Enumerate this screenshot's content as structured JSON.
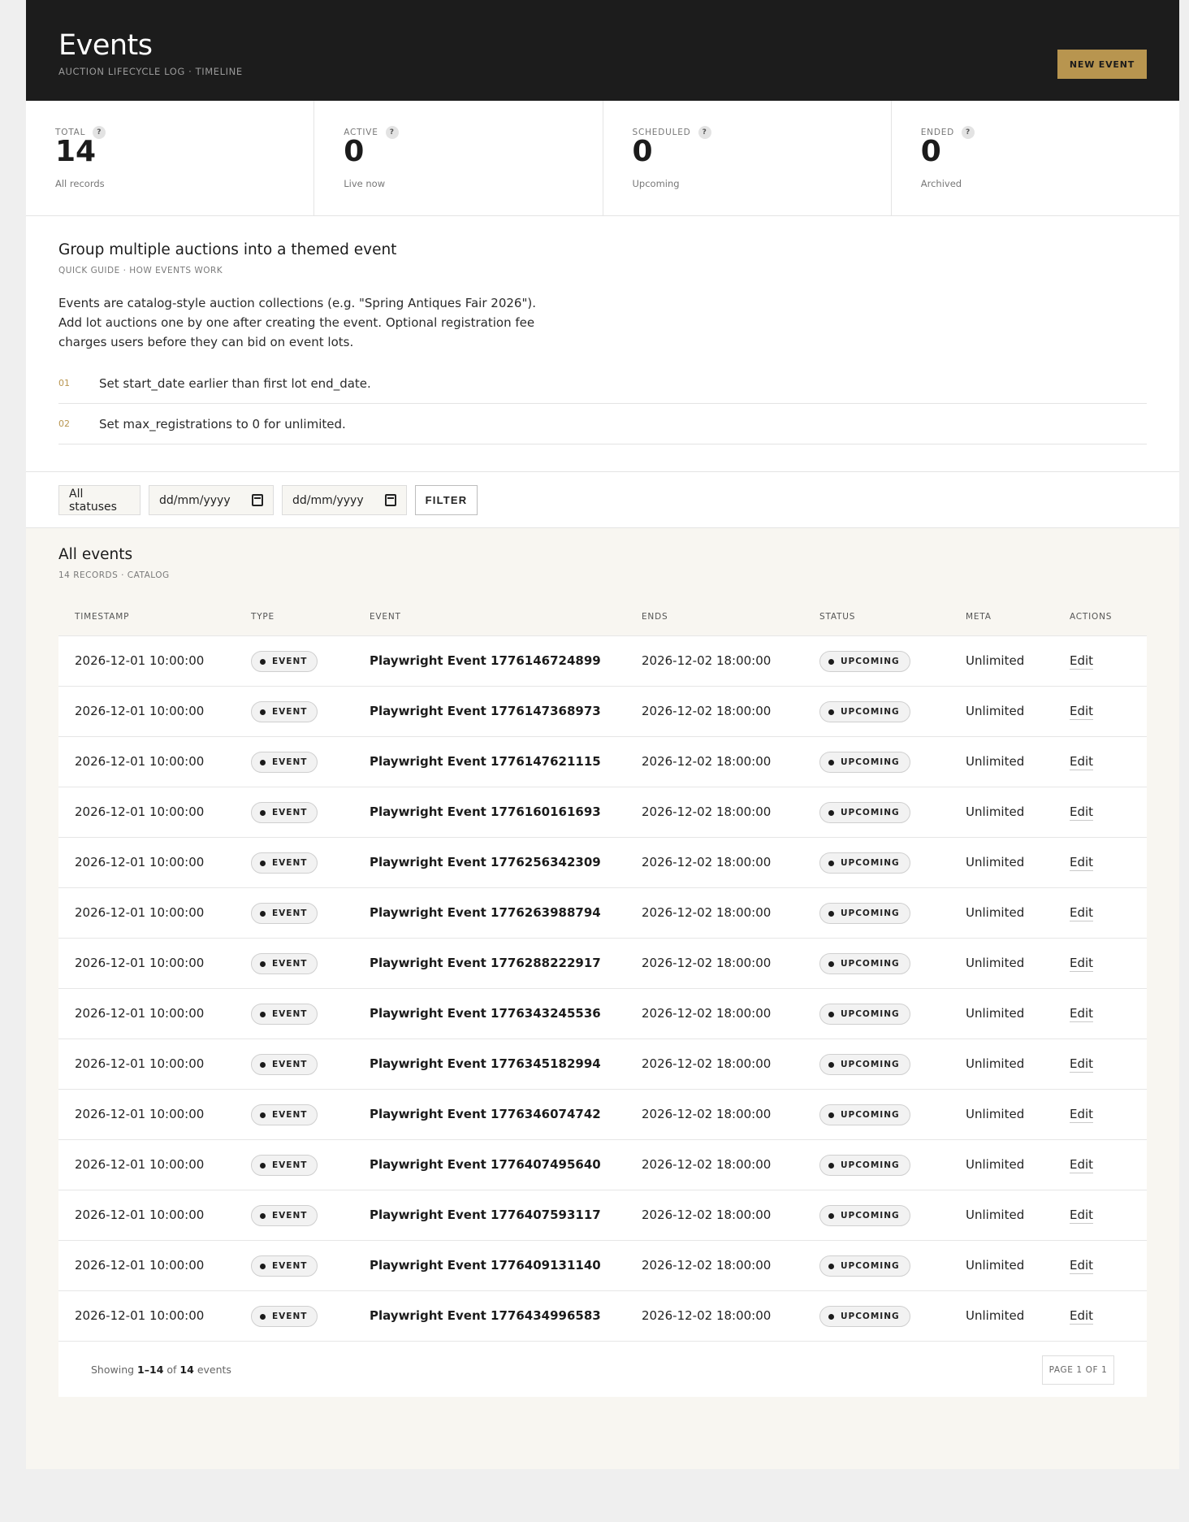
{
  "header": {
    "title": "Events",
    "subtitle": "AUCTION LIFECYCLE LOG · TIMELINE",
    "new_button": "NEW EVENT"
  },
  "stats": [
    {
      "label": "TOTAL",
      "value": "14",
      "caption": "All records"
    },
    {
      "label": "ACTIVE",
      "value": "0",
      "caption": "Live now"
    },
    {
      "label": "SCHEDULED",
      "value": "0",
      "caption": "Upcoming"
    },
    {
      "label": "ENDED",
      "value": "0",
      "caption": "Archived"
    }
  ],
  "help_glyph": "?",
  "guide": {
    "title": "Group multiple auctions into a themed event",
    "subtitle": "QUICK GUIDE · HOW EVENTS WORK",
    "description": "Events are catalog-style auction collections (e.g. \"Spring Antiques Fair 2026\"). Add lot auctions one by one after creating the event. Optional registration fee charges users before they can bid on event lots.",
    "steps": [
      {
        "num": "01",
        "text": "Set start_date earlier than first lot end_date."
      },
      {
        "num": "02",
        "text": "Set max_registrations to 0 for unlimited."
      }
    ]
  },
  "filters": {
    "status_select": "All statuses",
    "date_from_placeholder": "dd/mm/yyyy",
    "date_to_placeholder": "dd/mm/yyyy",
    "filter_button": "FILTER"
  },
  "list": {
    "title": "All events",
    "subtitle": "14 RECORDS · CATALOG",
    "columns": [
      "TIMESTAMP",
      "TYPE",
      "EVENT",
      "ENDS",
      "STATUS",
      "META",
      "ACTIONS"
    ],
    "rows": [
      {
        "timestamp": "2026-12-01 10:00:00",
        "type": "EVENT",
        "event": "Playwright Event 1776146724899",
        "ends": "2026-12-02 18:00:00",
        "status": "UPCOMING",
        "meta": "Unlimited",
        "action": "Edit"
      },
      {
        "timestamp": "2026-12-01 10:00:00",
        "type": "EVENT",
        "event": "Playwright Event 1776147368973",
        "ends": "2026-12-02 18:00:00",
        "status": "UPCOMING",
        "meta": "Unlimited",
        "action": "Edit"
      },
      {
        "timestamp": "2026-12-01 10:00:00",
        "type": "EVENT",
        "event": "Playwright Event 1776147621115",
        "ends": "2026-12-02 18:00:00",
        "status": "UPCOMING",
        "meta": "Unlimited",
        "action": "Edit"
      },
      {
        "timestamp": "2026-12-01 10:00:00",
        "type": "EVENT",
        "event": "Playwright Event 1776160161693",
        "ends": "2026-12-02 18:00:00",
        "status": "UPCOMING",
        "meta": "Unlimited",
        "action": "Edit"
      },
      {
        "timestamp": "2026-12-01 10:00:00",
        "type": "EVENT",
        "event": "Playwright Event 1776256342309",
        "ends": "2026-12-02 18:00:00",
        "status": "UPCOMING",
        "meta": "Unlimited",
        "action": "Edit"
      },
      {
        "timestamp": "2026-12-01 10:00:00",
        "type": "EVENT",
        "event": "Playwright Event 1776263988794",
        "ends": "2026-12-02 18:00:00",
        "status": "UPCOMING",
        "meta": "Unlimited",
        "action": "Edit"
      },
      {
        "timestamp": "2026-12-01 10:00:00",
        "type": "EVENT",
        "event": "Playwright Event 1776288222917",
        "ends": "2026-12-02 18:00:00",
        "status": "UPCOMING",
        "meta": "Unlimited",
        "action": "Edit"
      },
      {
        "timestamp": "2026-12-01 10:00:00",
        "type": "EVENT",
        "event": "Playwright Event 1776343245536",
        "ends": "2026-12-02 18:00:00",
        "status": "UPCOMING",
        "meta": "Unlimited",
        "action": "Edit"
      },
      {
        "timestamp": "2026-12-01 10:00:00",
        "type": "EVENT",
        "event": "Playwright Event 1776345182994",
        "ends": "2026-12-02 18:00:00",
        "status": "UPCOMING",
        "meta": "Unlimited",
        "action": "Edit"
      },
      {
        "timestamp": "2026-12-01 10:00:00",
        "type": "EVENT",
        "event": "Playwright Event 1776346074742",
        "ends": "2026-12-02 18:00:00",
        "status": "UPCOMING",
        "meta": "Unlimited",
        "action": "Edit"
      },
      {
        "timestamp": "2026-12-01 10:00:00",
        "type": "EVENT",
        "event": "Playwright Event 1776407495640",
        "ends": "2026-12-02 18:00:00",
        "status": "UPCOMING",
        "meta": "Unlimited",
        "action": "Edit"
      },
      {
        "timestamp": "2026-12-01 10:00:00",
        "type": "EVENT",
        "event": "Playwright Event 1776407593117",
        "ends": "2026-12-02 18:00:00",
        "status": "UPCOMING",
        "meta": "Unlimited",
        "action": "Edit"
      },
      {
        "timestamp": "2026-12-01 10:00:00",
        "type": "EVENT",
        "event": "Playwright Event 1776409131140",
        "ends": "2026-12-02 18:00:00",
        "status": "UPCOMING",
        "meta": "Unlimited",
        "action": "Edit"
      },
      {
        "timestamp": "2026-12-01 10:00:00",
        "type": "EVENT",
        "event": "Playwright Event 1776434996583",
        "ends": "2026-12-02 18:00:00",
        "status": "UPCOMING",
        "meta": "Unlimited",
        "action": "Edit"
      }
    ]
  },
  "footer": {
    "showing_prefix": "Showing",
    "range": "1–14",
    "of_word": "of",
    "total": "14",
    "suffix": "events",
    "page_label": "PAGE 1 OF 1"
  },
  "colors": {
    "accent": "#b8954f",
    "header_bg": "#1c1c1c",
    "page_bg": "#f8f6f1"
  }
}
